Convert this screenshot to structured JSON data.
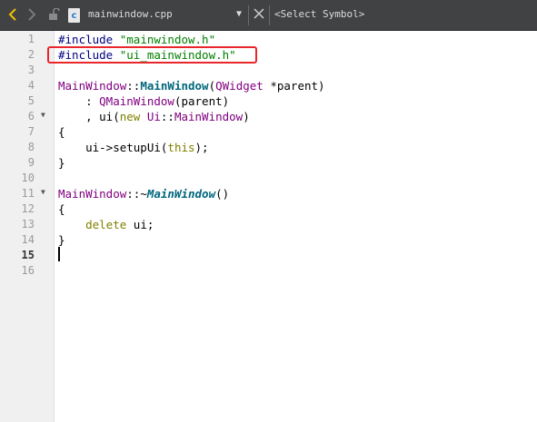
{
  "toolbar": {
    "file_name": "mainwindow.cpp",
    "file_icon_letter": "c",
    "symbol_selector": "<Select Symbol>"
  },
  "editor": {
    "line_numbers": [
      "1",
      "2",
      "3",
      "4",
      "5",
      "6",
      "7",
      "8",
      "9",
      "10",
      "11",
      "12",
      "13",
      "14",
      "15",
      "16"
    ],
    "current_line": "15",
    "lines": {
      "l1_directive": "#include",
      "l1_file": "\"mainwindow.h\"",
      "l2_directive": "#include",
      "l2_file": "\"ui_mainwindow.h\"",
      "l4_class": "MainWindow",
      "l4_sep": "::",
      "l4_func": "MainWindow",
      "l4_open": "(",
      "l4_type": "QWidget",
      "l4_param": " *parent)",
      "l5_indent": "    : ",
      "l5_base": "QMainWindow",
      "l5_rest": "(parent)",
      "l6_prefix": "    , ui(",
      "l6_new": "new",
      "l6_ns": " Ui",
      "l6_sep": "::",
      "l6_type": "MainWindow",
      "l6_end": ")",
      "l7": "{",
      "l8_pre": "    ui->setupUi(",
      "l8_this": "this",
      "l8_end": ");",
      "l9": "}",
      "l11_class": "MainWindow",
      "l11_sep": "::~",
      "l11_func": "MainWindow",
      "l11_end": "()",
      "l12": "{",
      "l13_kw": "    delete",
      "l13_rest": " ui;",
      "l14": "}"
    }
  },
  "colors": {
    "highlight_box": "#e8262b",
    "toolbar_bg": "#404244"
  }
}
